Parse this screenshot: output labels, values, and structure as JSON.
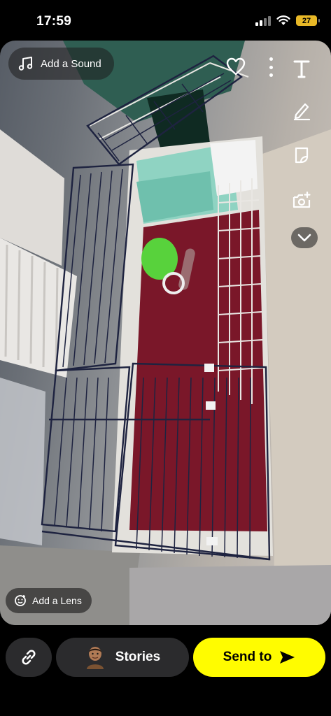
{
  "status_bar": {
    "time": "17:59",
    "battery_level": "27",
    "icons": [
      "cellular-signal-icon",
      "wifi-icon",
      "battery-icon"
    ],
    "battery_color": "#e8b827"
  },
  "overlay": {
    "add_sound_label": "Add a Sound",
    "add_lens_label": "Add a Lens",
    "tools": [
      "text-tool-icon",
      "pen-tool-icon",
      "sticker-tool-icon",
      "camera-plus-icon",
      "chevron-down-icon"
    ],
    "top_actions": [
      "heart-icon",
      "more-options-icon"
    ]
  },
  "bottom_bar": {
    "stories_label": "Stories",
    "send_label": "Send to",
    "send_color": "#fffc00",
    "button_bg": "#2b2b2d"
  }
}
